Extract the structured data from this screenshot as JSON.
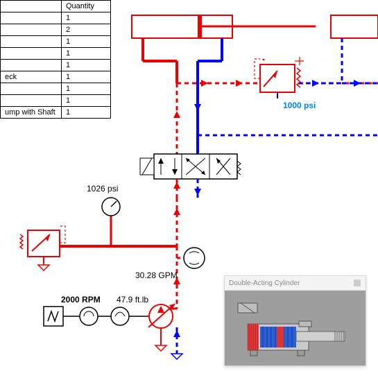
{
  "bom": {
    "header": {
      "qty": "Quantity"
    },
    "rows": [
      {
        "name": "",
        "qty": "1"
      },
      {
        "name": "",
        "qty": "2"
      },
      {
        "name": "",
        "qty": "1"
      },
      {
        "name": "",
        "qty": "1"
      },
      {
        "name": "",
        "qty": "1"
      },
      {
        "name": "eck",
        "qty": "1"
      },
      {
        "name": "",
        "qty": "1"
      },
      {
        "name": "",
        "qty": "1"
      },
      {
        "name": "ump with Shaft",
        "qty": "1"
      }
    ]
  },
  "readouts": {
    "pressure1": "1026 psi",
    "pressure2": "1000 psi",
    "flow": "30.28 GPM",
    "rpm": "2000 RPM",
    "torque": "47.9 ft.lb"
  },
  "popup": {
    "title": "Double-Acting Cylinder"
  }
}
